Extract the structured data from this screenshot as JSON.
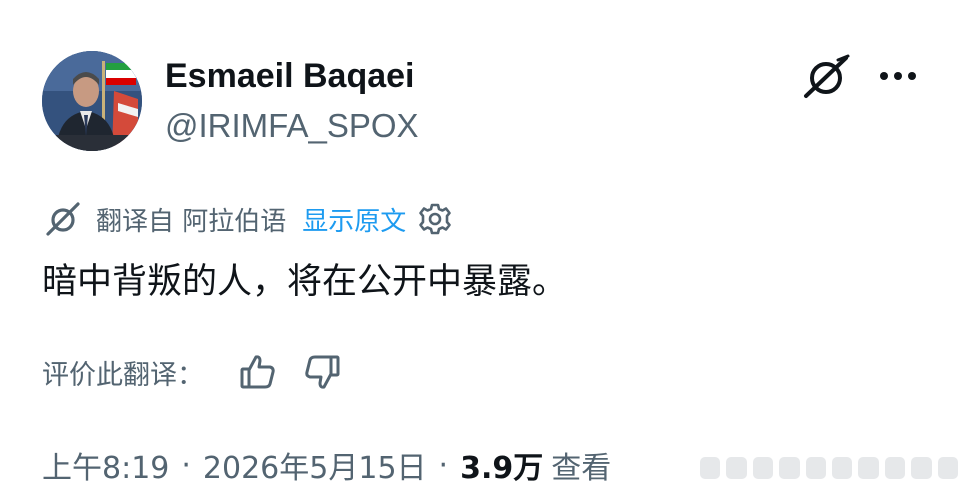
{
  "author": {
    "name": "Esmaeil Baqaei",
    "handle": "@IRIMFA_SPOX",
    "avatar_icon": "avatar-photo"
  },
  "header_actions": {
    "grok_icon": "grok-icon",
    "more_icon": "more-options-icon"
  },
  "translation": {
    "icon": "grok-translate-icon",
    "prefix": "翻译自 阿拉伯语",
    "show_original": "显示原文",
    "settings_icon": "gear-icon"
  },
  "tweet": {
    "text": "暗中背叛的人，将在公开中暴露。"
  },
  "rating": {
    "label": "评价此翻译：",
    "thumbs_up_icon": "thumbs-up-icon",
    "thumbs_down_icon": "thumbs-down-icon"
  },
  "meta": {
    "time": "上午8:19",
    "separator": "·",
    "date": "2026年5月15日",
    "views_count": "3.9万",
    "views_label": "查看"
  },
  "colors": {
    "text_primary": "#0f1419",
    "text_secondary": "#536471",
    "link": "#1d9bf0",
    "background": "#ffffff"
  }
}
